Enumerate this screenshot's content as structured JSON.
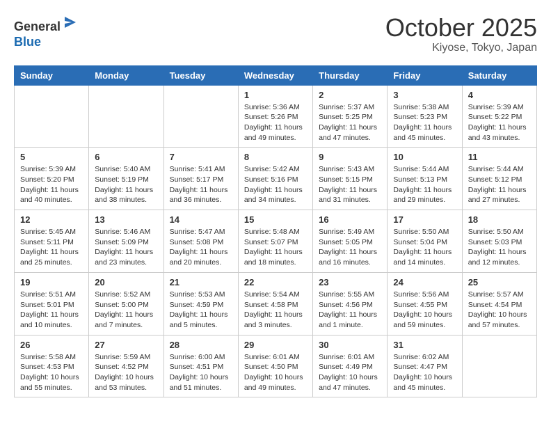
{
  "header": {
    "logo_line1": "General",
    "logo_line2": "Blue",
    "month_title": "October 2025",
    "location": "Kiyose, Tokyo, Japan"
  },
  "weekdays": [
    "Sunday",
    "Monday",
    "Tuesday",
    "Wednesday",
    "Thursday",
    "Friday",
    "Saturday"
  ],
  "weeks": [
    [
      {
        "day": "",
        "info": ""
      },
      {
        "day": "",
        "info": ""
      },
      {
        "day": "",
        "info": ""
      },
      {
        "day": "1",
        "info": "Sunrise: 5:36 AM\nSunset: 5:26 PM\nDaylight: 11 hours\nand 49 minutes."
      },
      {
        "day": "2",
        "info": "Sunrise: 5:37 AM\nSunset: 5:25 PM\nDaylight: 11 hours\nand 47 minutes."
      },
      {
        "day": "3",
        "info": "Sunrise: 5:38 AM\nSunset: 5:23 PM\nDaylight: 11 hours\nand 45 minutes."
      },
      {
        "day": "4",
        "info": "Sunrise: 5:39 AM\nSunset: 5:22 PM\nDaylight: 11 hours\nand 43 minutes."
      }
    ],
    [
      {
        "day": "5",
        "info": "Sunrise: 5:39 AM\nSunset: 5:20 PM\nDaylight: 11 hours\nand 40 minutes."
      },
      {
        "day": "6",
        "info": "Sunrise: 5:40 AM\nSunset: 5:19 PM\nDaylight: 11 hours\nand 38 minutes."
      },
      {
        "day": "7",
        "info": "Sunrise: 5:41 AM\nSunset: 5:17 PM\nDaylight: 11 hours\nand 36 minutes."
      },
      {
        "day": "8",
        "info": "Sunrise: 5:42 AM\nSunset: 5:16 PM\nDaylight: 11 hours\nand 34 minutes."
      },
      {
        "day": "9",
        "info": "Sunrise: 5:43 AM\nSunset: 5:15 PM\nDaylight: 11 hours\nand 31 minutes."
      },
      {
        "day": "10",
        "info": "Sunrise: 5:44 AM\nSunset: 5:13 PM\nDaylight: 11 hours\nand 29 minutes."
      },
      {
        "day": "11",
        "info": "Sunrise: 5:44 AM\nSunset: 5:12 PM\nDaylight: 11 hours\nand 27 minutes."
      }
    ],
    [
      {
        "day": "12",
        "info": "Sunrise: 5:45 AM\nSunset: 5:11 PM\nDaylight: 11 hours\nand 25 minutes."
      },
      {
        "day": "13",
        "info": "Sunrise: 5:46 AM\nSunset: 5:09 PM\nDaylight: 11 hours\nand 23 minutes."
      },
      {
        "day": "14",
        "info": "Sunrise: 5:47 AM\nSunset: 5:08 PM\nDaylight: 11 hours\nand 20 minutes."
      },
      {
        "day": "15",
        "info": "Sunrise: 5:48 AM\nSunset: 5:07 PM\nDaylight: 11 hours\nand 18 minutes."
      },
      {
        "day": "16",
        "info": "Sunrise: 5:49 AM\nSunset: 5:05 PM\nDaylight: 11 hours\nand 16 minutes."
      },
      {
        "day": "17",
        "info": "Sunrise: 5:50 AM\nSunset: 5:04 PM\nDaylight: 11 hours\nand 14 minutes."
      },
      {
        "day": "18",
        "info": "Sunrise: 5:50 AM\nSunset: 5:03 PM\nDaylight: 11 hours\nand 12 minutes."
      }
    ],
    [
      {
        "day": "19",
        "info": "Sunrise: 5:51 AM\nSunset: 5:01 PM\nDaylight: 11 hours\nand 10 minutes."
      },
      {
        "day": "20",
        "info": "Sunrise: 5:52 AM\nSunset: 5:00 PM\nDaylight: 11 hours\nand 7 minutes."
      },
      {
        "day": "21",
        "info": "Sunrise: 5:53 AM\nSunset: 4:59 PM\nDaylight: 11 hours\nand 5 minutes."
      },
      {
        "day": "22",
        "info": "Sunrise: 5:54 AM\nSunset: 4:58 PM\nDaylight: 11 hours\nand 3 minutes."
      },
      {
        "day": "23",
        "info": "Sunrise: 5:55 AM\nSunset: 4:56 PM\nDaylight: 11 hours\nand 1 minute."
      },
      {
        "day": "24",
        "info": "Sunrise: 5:56 AM\nSunset: 4:55 PM\nDaylight: 10 hours\nand 59 minutes."
      },
      {
        "day": "25",
        "info": "Sunrise: 5:57 AM\nSunset: 4:54 PM\nDaylight: 10 hours\nand 57 minutes."
      }
    ],
    [
      {
        "day": "26",
        "info": "Sunrise: 5:58 AM\nSunset: 4:53 PM\nDaylight: 10 hours\nand 55 minutes."
      },
      {
        "day": "27",
        "info": "Sunrise: 5:59 AM\nSunset: 4:52 PM\nDaylight: 10 hours\nand 53 minutes."
      },
      {
        "day": "28",
        "info": "Sunrise: 6:00 AM\nSunset: 4:51 PM\nDaylight: 10 hours\nand 51 minutes."
      },
      {
        "day": "29",
        "info": "Sunrise: 6:01 AM\nSunset: 4:50 PM\nDaylight: 10 hours\nand 49 minutes."
      },
      {
        "day": "30",
        "info": "Sunrise: 6:01 AM\nSunset: 4:49 PM\nDaylight: 10 hours\nand 47 minutes."
      },
      {
        "day": "31",
        "info": "Sunrise: 6:02 AM\nSunset: 4:47 PM\nDaylight: 10 hours\nand 45 minutes."
      },
      {
        "day": "",
        "info": ""
      }
    ]
  ]
}
